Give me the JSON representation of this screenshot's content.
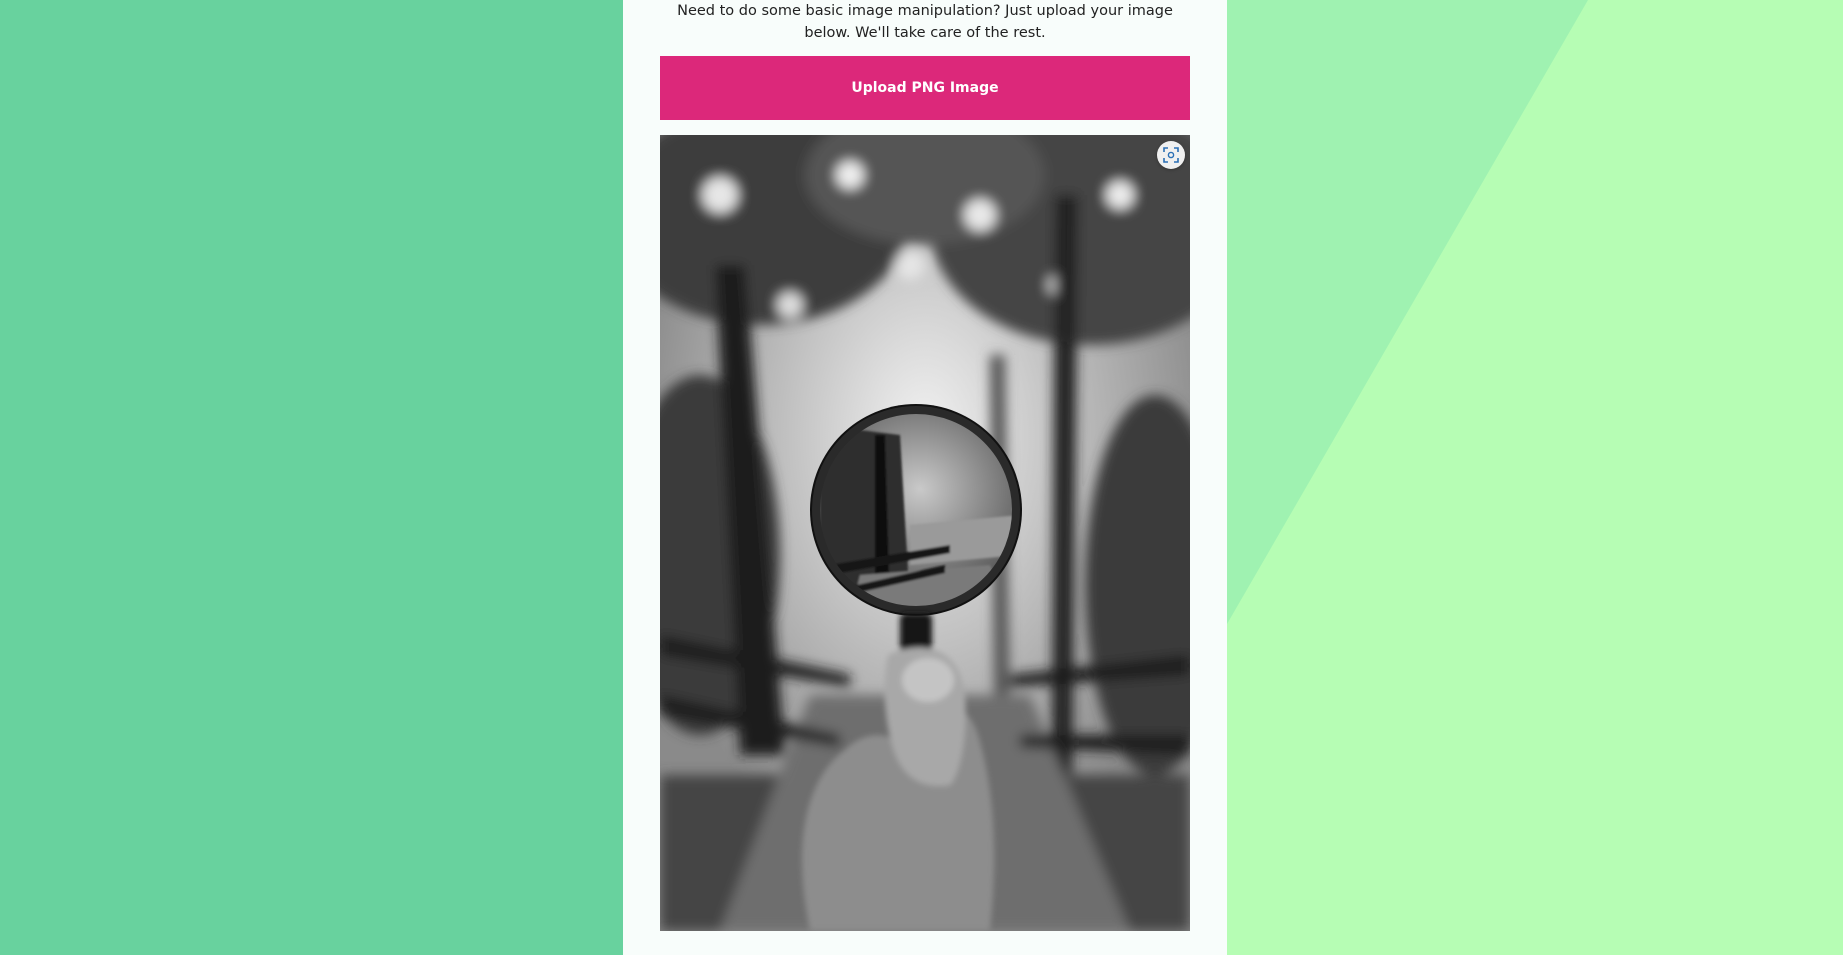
{
  "page": {
    "intro_text": "Need to do some basic image manipulation? Just upload your image below. We'll take care of the rest."
  },
  "upload": {
    "button_label": "Upload PNG Image"
  },
  "preview": {
    "image_description_icon": "magnifying-glass-photo",
    "expand_icon": "focus-frame-icon"
  },
  "colors": {
    "background_left": "#68d29e",
    "background_mid": "#9ff2b1",
    "background_right": "#b6fdb4",
    "card": "#f8fdfb",
    "accent": "#dc287a"
  }
}
